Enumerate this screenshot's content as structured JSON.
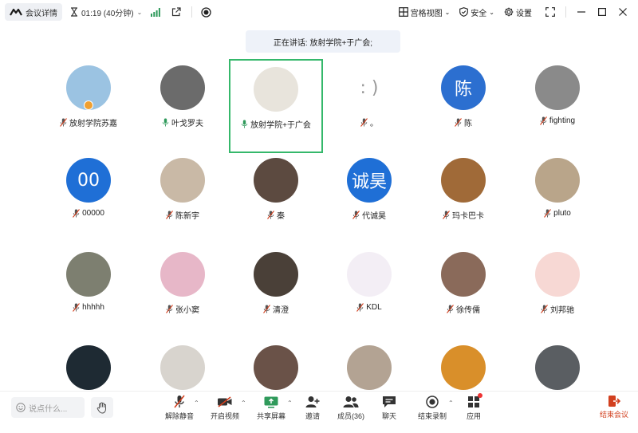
{
  "topbar": {
    "meeting_details": "会议详情",
    "timer": "01:19 (40分钟)",
    "layout_view": "宫格视图",
    "security": "安全",
    "settings": "设置"
  },
  "speaker_banner": "正在讲话: 放射学院+于广会;",
  "participants": [
    {
      "name": "放射学院苏嘉",
      "avatar_text": "",
      "avatar_color": "#9bc3e2",
      "mic": "muted",
      "host_badge": true
    },
    {
      "name": "叶戈罗夫",
      "avatar_text": "",
      "avatar_color": "#6b6b6b",
      "mic": "on"
    },
    {
      "name": "放射学院+于广会",
      "avatar_text": "",
      "avatar_color": "#e8e4dc",
      "mic": "on",
      "speaking": true
    },
    {
      "name": "。",
      "avatar_text": ": )",
      "avatar_color": "#ffffff",
      "mic": "muted"
    },
    {
      "name": "陈",
      "avatar_text": "陈",
      "avatar_color": "#2c6fd0",
      "mic": "muted"
    },
    {
      "name": "fighting",
      "avatar_text": "",
      "avatar_color": "#8a8a8a",
      "mic": "muted"
    },
    {
      "name": "00000",
      "avatar_text": "00",
      "avatar_color": "#1f6fd6",
      "mic": "muted"
    },
    {
      "name": "陈新宇",
      "avatar_text": "",
      "avatar_color": "#c9b9a6",
      "mic": "muted"
    },
    {
      "name": "秦",
      "avatar_text": "",
      "avatar_color": "#5c4a40",
      "mic": "muted"
    },
    {
      "name": "代诚昊",
      "avatar_text": "诚昊",
      "avatar_color": "#1f6fd6",
      "mic": "muted"
    },
    {
      "name": "玛卡巴卡",
      "avatar_text": "",
      "avatar_color": "#a06a38",
      "mic": "muted"
    },
    {
      "name": "pluto",
      "avatar_text": "",
      "avatar_color": "#b9a58a",
      "mic": "muted"
    },
    {
      "name": "hhhhh",
      "avatar_text": "",
      "avatar_color": "#7d7f70",
      "mic": "muted"
    },
    {
      "name": "张小窦",
      "avatar_text": "",
      "avatar_color": "#e7b7c8",
      "mic": "muted"
    },
    {
      "name": "清澄",
      "avatar_text": "",
      "avatar_color": "#4a4038",
      "mic": "muted"
    },
    {
      "name": "KDL",
      "avatar_text": "",
      "avatar_color": "#f3eef5",
      "mic": "muted"
    },
    {
      "name": "徐传儒",
      "avatar_text": "",
      "avatar_color": "#8a6a5a",
      "mic": "muted"
    },
    {
      "name": "刘邦驰",
      "avatar_text": "",
      "avatar_color": "#f7d8d4",
      "mic": "muted"
    },
    {
      "name": "",
      "avatar_text": "",
      "avatar_color": "#1e2a33",
      "mic": "none"
    },
    {
      "name": "",
      "avatar_text": "",
      "avatar_color": "#d8d4ce",
      "mic": "none"
    },
    {
      "name": "",
      "avatar_text": "",
      "avatar_color": "#6a5248",
      "mic": "none"
    },
    {
      "name": "",
      "avatar_text": "",
      "avatar_color": "#b3a393",
      "mic": "none"
    },
    {
      "name": "",
      "avatar_text": "",
      "avatar_color": "#d98f2a",
      "mic": "none"
    },
    {
      "name": "",
      "avatar_text": "",
      "avatar_color": "#5a5e62",
      "mic": "none"
    }
  ],
  "bottombar": {
    "chat_placeholder": "说点什么...",
    "unmute": "解除静音",
    "start_video": "开启视频",
    "share_screen": "共享屏幕",
    "invite": "邀请",
    "members": "成员(36)",
    "chat": "聊天",
    "end_recording": "结束录制",
    "apps": "应用",
    "end_meeting": "结束会议"
  },
  "colors": {
    "accent_green": "#35b86b",
    "mic_muted": "#d2401f",
    "mic_on": "#2f9a5b",
    "end_red": "#d2401f"
  }
}
